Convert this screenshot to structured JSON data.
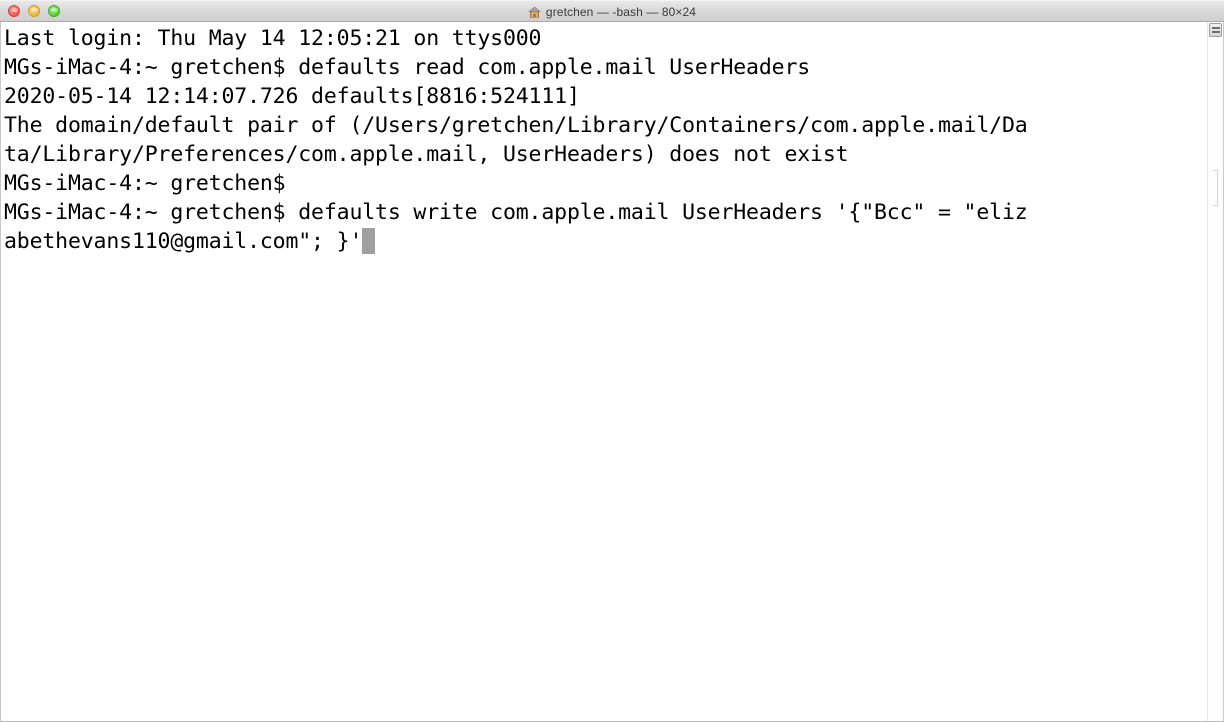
{
  "window": {
    "title": "gretchen — -bash — 80×24",
    "home_icon": "home-icon",
    "traffic_lights": [
      {
        "name": "close",
        "color": "#ee5f57"
      },
      {
        "name": "minimize",
        "color": "#e9b94b"
      },
      {
        "name": "maximize",
        "color": "#5fce3a"
      }
    ]
  },
  "terminal": {
    "shell": "-bash",
    "size": "80×24",
    "prompt": "MGs-iMac-4:~ gretchen$",
    "cursor": "block",
    "lines": [
      "Last login: Thu May 14 12:05:21 on ttys000",
      "MGs-iMac-4:~ gretchen$ defaults read com.apple.mail UserHeaders",
      "2020-05-14 12:14:07.726 defaults[8816:524111]",
      "The domain/default pair of (/Users/gretchen/Library/Containers/com.apple.mail/Da",
      "ta/Library/Preferences/com.apple.mail, UserHeaders) does not exist",
      "MGs-iMac-4:~ gretchen$",
      "MGs-iMac-4:~ gretchen$ defaults write com.apple.mail UserHeaders '{\"Bcc\" = \"eliz",
      "abethevans110@gmail.com\"; }'"
    ]
  },
  "colors": {
    "background": "#ffffff",
    "foreground": "#000000",
    "titlebar": "#d8d8d8",
    "cursor": "#a0a0a0"
  }
}
